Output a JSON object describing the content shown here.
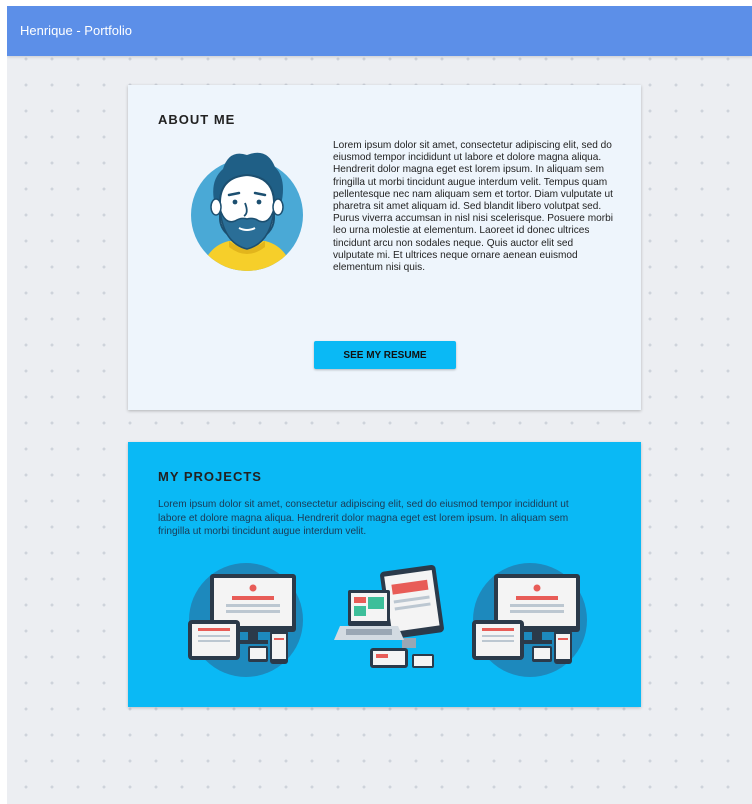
{
  "navbar": {
    "brand": "Henrique - Portfolio"
  },
  "about": {
    "title": "ABOUT ME",
    "avatar_icon": "bearded-man-avatar-icon",
    "text": "Lorem ipsum dolor sit amet, consectetur adipiscing elit, sed do eiusmod tempor incididunt ut labore et dolore magna aliqua. Hendrerit dolor magna eget est lorem ipsum. In aliquam sem fringilla ut morbi tincidunt augue interdum velit. Tempus quam pellentesque nec nam aliquam sem et tortor. Diam vulputate ut pharetra sit amet aliquam id. Sed blandit libero volutpat sed. Purus viverra accumsan in nisl nisi scelerisque. Posuere morbi leo urna molestie at elementum. Laoreet id donec ultrices tincidunt arcu non sodales neque. Quis auctor elit sed vulputate mi. Et ultrices neque ornare aenean euismod elementum nisi quis.",
    "resume_button": "SEE MY RESUME"
  },
  "projects": {
    "title": "MY PROJECTS",
    "text": "Lorem ipsum dolor sit amet, consectetur adipiscing elit, sed do eiusmod tempor incididunt ut labore et dolore magna aliqua. Hendrerit dolor magna eget est lorem ipsum. In aliquam sem fringilla ut morbi tincidunt augue interdum velit.",
    "images": [
      {
        "icon": "responsive-devices-icon"
      },
      {
        "icon": "multi-device-icon"
      },
      {
        "icon": "responsive-devices-icon"
      }
    ]
  },
  "colors": {
    "navbar": "#5c8fe8",
    "accent": "#0ab9f5",
    "card_bg": "#eef5fc",
    "page_bg": "#eceef2"
  }
}
